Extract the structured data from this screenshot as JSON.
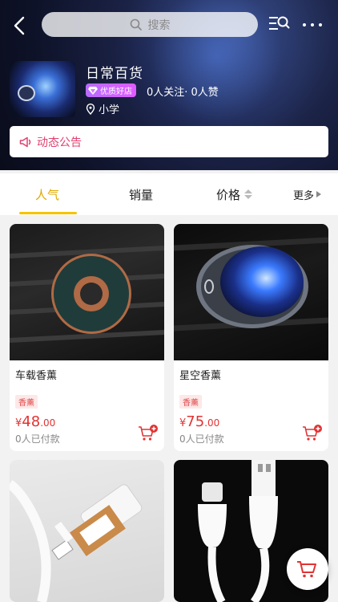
{
  "header": {
    "search_placeholder": "搜索",
    "store_name": "日常百货",
    "badge": "优质好店",
    "follow_stats": "0人关注· 0人赞",
    "location": "小学",
    "notice": "动态公告"
  },
  "tabs": [
    {
      "label": "人气"
    },
    {
      "label": "销量"
    },
    {
      "label": "价格"
    },
    {
      "label": "更多"
    }
  ],
  "products": [
    {
      "name": "车载香薰",
      "tag": "香薰",
      "currency": "¥",
      "price_int": "48",
      "price_dec": ".00",
      "paid": "0人已付款"
    },
    {
      "name": "星空香薰",
      "tag": "香薰",
      "currency": "¥",
      "price_int": "75",
      "price_dec": ".00",
      "paid": "0人已付款"
    },
    {
      "name": "",
      "tag": "",
      "currency": "",
      "price_int": "",
      "price_dec": "",
      "paid": ""
    },
    {
      "name": "",
      "tag": "",
      "currency": "",
      "price_int": "",
      "price_dec": "",
      "paid": ""
    }
  ],
  "colors": {
    "accent_yellow": "#f5c400",
    "price_red": "#e23333",
    "notice_pink": "#e04070",
    "badge_purple": "#c766ff"
  }
}
